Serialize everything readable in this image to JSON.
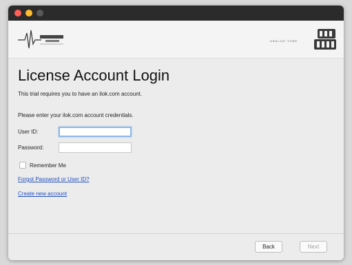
{
  "window": {
    "header": {
      "left_logo_icon": "suhr-logo-icon",
      "brand_text": "ANALOG·TONE",
      "right_logo_icon": "cory-wong-logo-icon"
    }
  },
  "main": {
    "title": "License Account Login",
    "subtitle": "This trial requires you to have an ilok.com account.",
    "instructions": "Please enter your ilok.com account credentials.",
    "user_id_label": "User ID:",
    "user_id_value": "",
    "password_label": "Password:",
    "password_value": "",
    "remember_label": "Remember Me",
    "forgot_link": "Forgot Password or User ID?",
    "create_link": "Create new account"
  },
  "footer": {
    "back_label": "Back",
    "next_label": "Next"
  },
  "colors": {
    "link": "#1f4fc4",
    "focus_ring": "#8db7e8",
    "titlebar": "#2b2b2b"
  }
}
